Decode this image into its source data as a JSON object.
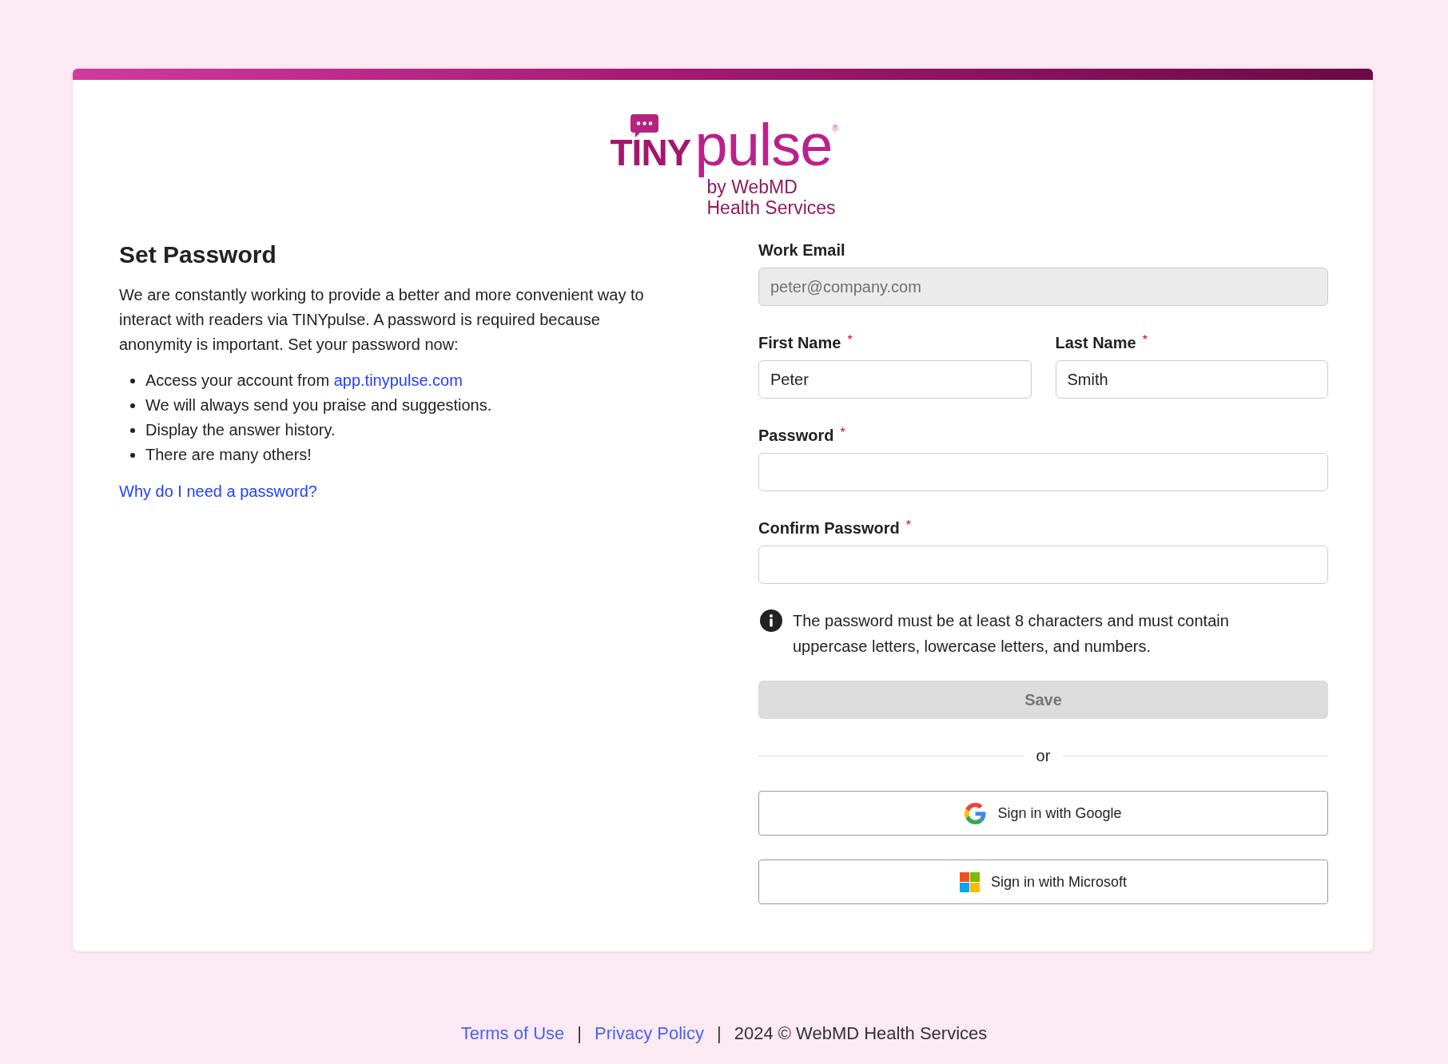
{
  "logo": {
    "wordmark_bold": "TINY",
    "wordmark_light": "pulse",
    "registered_mark": "®",
    "byline": [
      "by WebMD",
      "Health Services"
    ]
  },
  "intro": {
    "title": "Set Password",
    "paragraph": "We are constantly working to provide a better and more convenient way to interact with readers via TINYpulse. A password is required because anonymity is important. Set your password now:",
    "bullets": [
      {
        "text": "Access your account from",
        "link": "app.tinypulse.com"
      },
      {
        "text": "We will always send you praise and suggestions."
      },
      {
        "text": "Display the answer history."
      },
      {
        "text": "There are many others!"
      }
    ],
    "help_link": "Why do I need a password?"
  },
  "form": {
    "field_rows": [
      [
        {
          "label": "Work Email",
          "value": "peter@company.com",
          "disabled": true
        }
      ],
      [
        {
          "label": "First Name",
          "required_mark": "*",
          "value": "Peter",
          "disabled": false
        },
        {
          "label": "Last Name",
          "required_mark": "*",
          "value": "Smith",
          "disabled": false
        }
      ],
      [
        {
          "label": "Password",
          "required_mark": "*",
          "disabled": false
        }
      ],
      [
        {
          "label": "Confirm Password",
          "required_mark": "*",
          "disabled": false
        }
      ]
    ],
    "password_hint": "The password must be at least 8 characters and must contain uppercase letters, lowercase letters, and numbers.",
    "save_button": {
      "label": "Save",
      "disabled": true
    },
    "divider_text": "or",
    "sso_buttons": [
      {
        "kind": "google",
        "label": "Sign in with Google"
      },
      {
        "kind": "microsoft",
        "label": "Sign in with Microsoft"
      }
    ]
  },
  "footer": [
    {
      "kind": "link",
      "text": "Terms of Use"
    },
    {
      "kind": "separator",
      "text": "|"
    },
    {
      "kind": "link",
      "text": "Privacy Policy"
    },
    {
      "kind": "separator",
      "text": "|"
    },
    {
      "kind": "text",
      "text": "2024 © WebMD Health Services"
    }
  ]
}
